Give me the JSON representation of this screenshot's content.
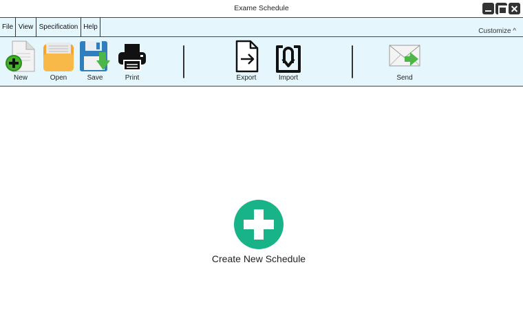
{
  "window": {
    "title": "Exame Schedule"
  },
  "menu": {
    "file": "File",
    "view": "View",
    "specification": "Specification",
    "help": "Help",
    "customize": "Customize ^"
  },
  "toolbar": {
    "new": "New",
    "open": "Open",
    "save": "Save",
    "print": "Print",
    "export": "Export",
    "import": "Import",
    "send": "Send"
  },
  "main": {
    "create_label": "Create New Schedule"
  },
  "colors": {
    "accent_green": "#19b388",
    "toolbar_bg": "#e6f6fd",
    "folder_orange": "#f7a531",
    "save_blue": "#2f7fbf"
  },
  "icons": [
    "new-document-icon",
    "open-folder-icon",
    "save-disk-icon",
    "printer-icon",
    "export-icon",
    "import-icon",
    "send-mail-icon",
    "plus-circle-icon"
  ]
}
